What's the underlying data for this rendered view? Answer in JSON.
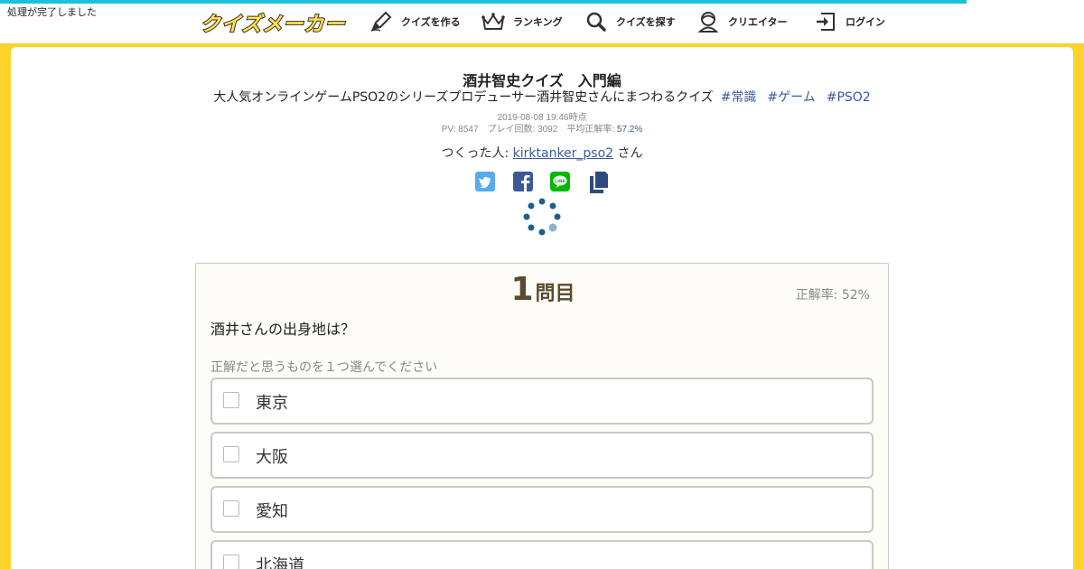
{
  "status": "処理が完了しました",
  "logo": "クイズメーカー",
  "nav": [
    {
      "label": "クイズを作る",
      "icon": "pencil-icon"
    },
    {
      "label": "ランキング",
      "icon": "crown-icon"
    },
    {
      "label": "クイズを探す",
      "icon": "search-icon"
    },
    {
      "label": "クリエイター",
      "icon": "user-icon"
    },
    {
      "label": "ログイン",
      "icon": "login-icon"
    }
  ],
  "quiz": {
    "title": "酒井智史クイズ　入門編",
    "description": "大人気オンラインゲームPSO2のシリーズプロデューサー酒井智史さんにまつわるクイズ",
    "tags": [
      "#常識",
      "#ゲーム",
      "#PSO2"
    ],
    "date": "2019-08-08 19:46時点",
    "stats_prefix": "PV: 8547　プレイ回数: 3092　平均正解率: ",
    "avg_rate": "57.2%",
    "creator_prefix": "つくった人: ",
    "creator_name": "kirktanker_pso2",
    "creator_suffix": " さん"
  },
  "share": [
    {
      "icon": "twitter-icon",
      "color": "#55acee"
    },
    {
      "icon": "facebook-icon",
      "color": "#3b5998"
    },
    {
      "icon": "line-icon",
      "color": "#00b900"
    },
    {
      "icon": "copy-icon",
      "color": "#2f4a80"
    }
  ],
  "question": {
    "number": "1",
    "suffix": "問目",
    "correct_rate": "正解率: 52%",
    "text": "酒井さんの出身地は？",
    "hint": "正解だと思うものを１つ選んでください",
    "choices": [
      "東京",
      "大阪",
      "愛知",
      "北海道"
    ]
  }
}
